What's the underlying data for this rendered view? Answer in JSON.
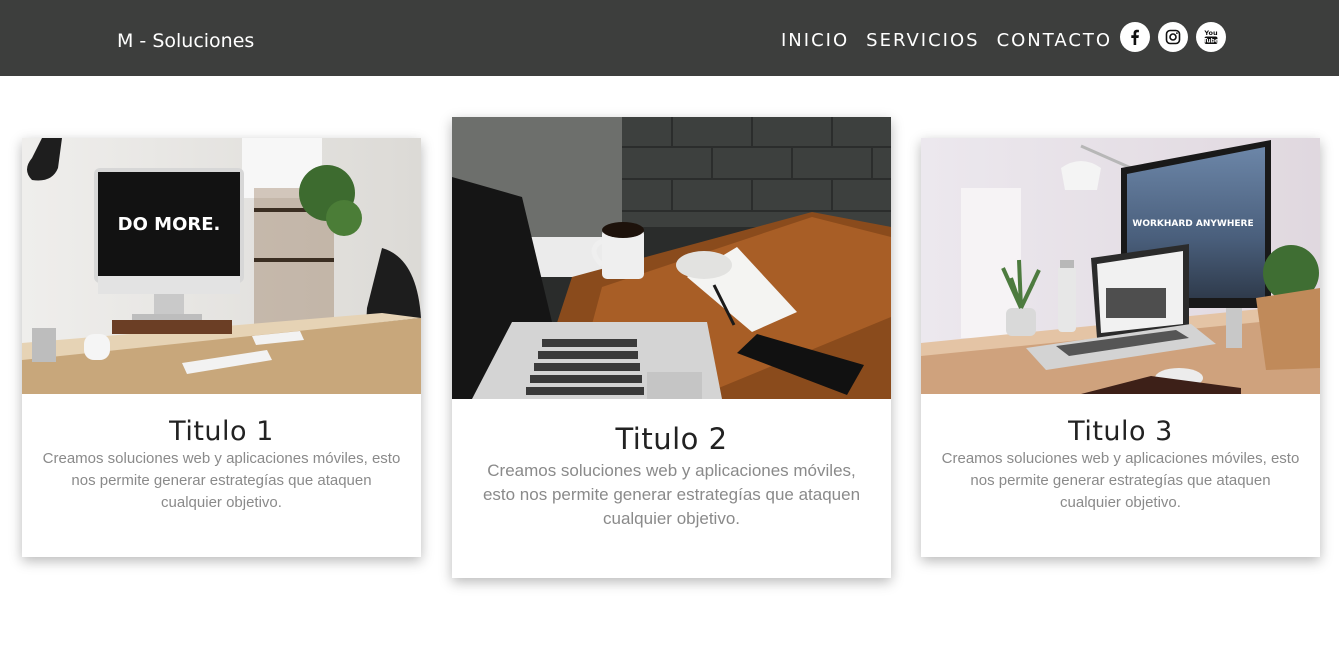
{
  "header": {
    "brand": "M - Soluciones",
    "nav": [
      {
        "label": "INICIO"
      },
      {
        "label": "SERVICIOS"
      },
      {
        "label": "CONTACTO"
      }
    ],
    "social": [
      {
        "icon": "facebook-icon"
      },
      {
        "icon": "instagram-icon"
      },
      {
        "icon": "youtube-icon",
        "text": "You Tube"
      }
    ],
    "colors": {
      "background": "#3d3e3d",
      "text": "#ffffff"
    }
  },
  "cards": [
    {
      "title": "Titulo 1",
      "description": "Creamos soluciones web y aplicaciones móviles, esto nos permite generar estrategías que ataquen cualquier objetivo.",
      "image": "desk-imac-photo",
      "image_text": "DO MORE."
    },
    {
      "title": "Titulo 2",
      "description": "Creamos soluciones web y aplicaciones móviles, esto nos permite generar estrategías que ataquen cualquier objetivo.",
      "image": "laptop-coffee-desk-photo"
    },
    {
      "title": "Titulo 3",
      "description": "Creamos soluciones web y aplicaciones móviles, esto nos permite generar estrategías que ataquen cualquier objetivo.",
      "image": "imac-laptop-workspace-photo",
      "image_text": "WORKHARD ANYWHERE"
    }
  ],
  "colors": {
    "title": "#222222",
    "description": "#8a8a8a",
    "page_background": "#ffffff"
  }
}
